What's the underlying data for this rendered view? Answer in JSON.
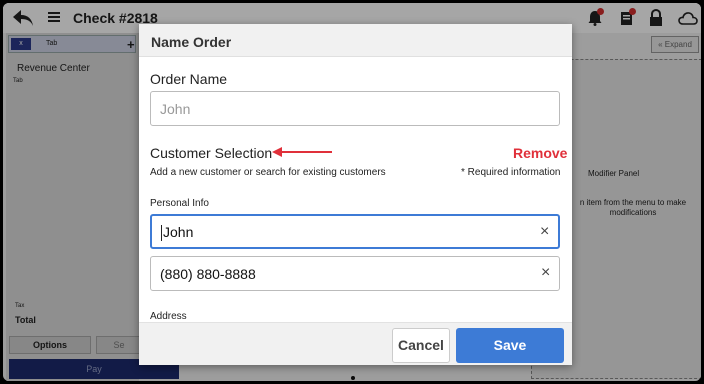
{
  "topbar": {
    "title": "Check #2818",
    "icons": [
      "back-arrow-icon",
      "menu-icon",
      "bell-icon",
      "ticket-icon",
      "lock-icon",
      "cloud-icon"
    ]
  },
  "left_panel": {
    "tab_close": "x",
    "tab_label": "Tab",
    "tab_add": "+",
    "revenue_center": "Revenue Center",
    "revenue_sub": "Tab",
    "tax_label": "Tax",
    "total_label": "Total",
    "options_label": "Options",
    "send_label": "Se",
    "pay_label": "Pay"
  },
  "right_panel": {
    "expand_label": "« Expand",
    "title": "Modifier Panel",
    "text": "n item from the menu to make modifications"
  },
  "modal": {
    "title": "Name Order",
    "order_name_label": "Order Name",
    "order_name_placeholder": "John",
    "customer_selection_label": "Customer Selection",
    "remove_label": "Remove",
    "helper_text": "Add a new customer or search for existing customers",
    "required_text": "* Required information",
    "personal_info_label": "Personal Info",
    "name_value": "John",
    "phone_value": "(880) 880-8888",
    "clear_glyph": "×",
    "address_label": "Address",
    "cancel_label": "Cancel",
    "save_label": "Save"
  },
  "colors": {
    "accent": "#3d7bd6",
    "remove": "#e0303a",
    "arrow": "#e0303a",
    "pay": "#1c2a6e"
  }
}
